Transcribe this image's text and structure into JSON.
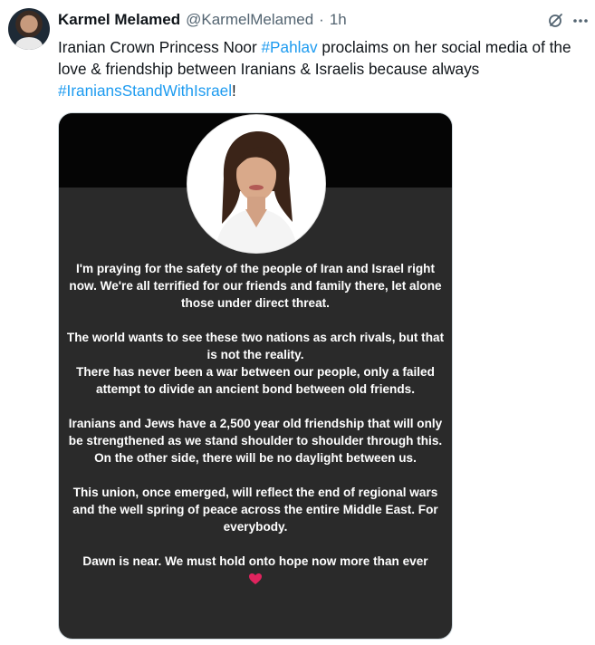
{
  "tweet": {
    "author_name": "Karmel Melamed",
    "handle": "@KarmelMelamed",
    "separator": "·",
    "time": "1h",
    "text_before": "Iranian Crown Princess Noor ",
    "hashtag1": "#Pahlav",
    "text_middle": " proclaims on her social media of the love & friendship between Iranians & Israelis because always ",
    "hashtag2": "#IraniansStandWithIsrael",
    "text_after": "!"
  },
  "media": {
    "paragraphs": [
      "I'm praying for the safety of the people of Iran and Israel right now. We're all terrified for our friends and family there, let alone those under direct threat.",
      "The world wants to see these two nations as arch rivals, but that is not the reality.",
      "There has never been a war between our people, only a failed attempt to divide an ancient bond between old friends.",
      "Iranians and Jews have a 2,500 year old friendship that will only be strengthened as we stand shoulder to shoulder through this. On the other side, there will be no daylight between us.",
      "This union, once emerged, will reflect the end of regional wars and the well spring of peace across the entire Middle East. For everybody.",
      "Dawn is near. We must hold onto hope now more than ever"
    ]
  },
  "icons": {
    "grok": "grok-icon",
    "more": "more-icon",
    "heart": "heart-icon"
  },
  "colors": {
    "accent": "#1d9bf0",
    "text": "#0f1419",
    "muted": "#536471",
    "heart": "#e0245e"
  }
}
